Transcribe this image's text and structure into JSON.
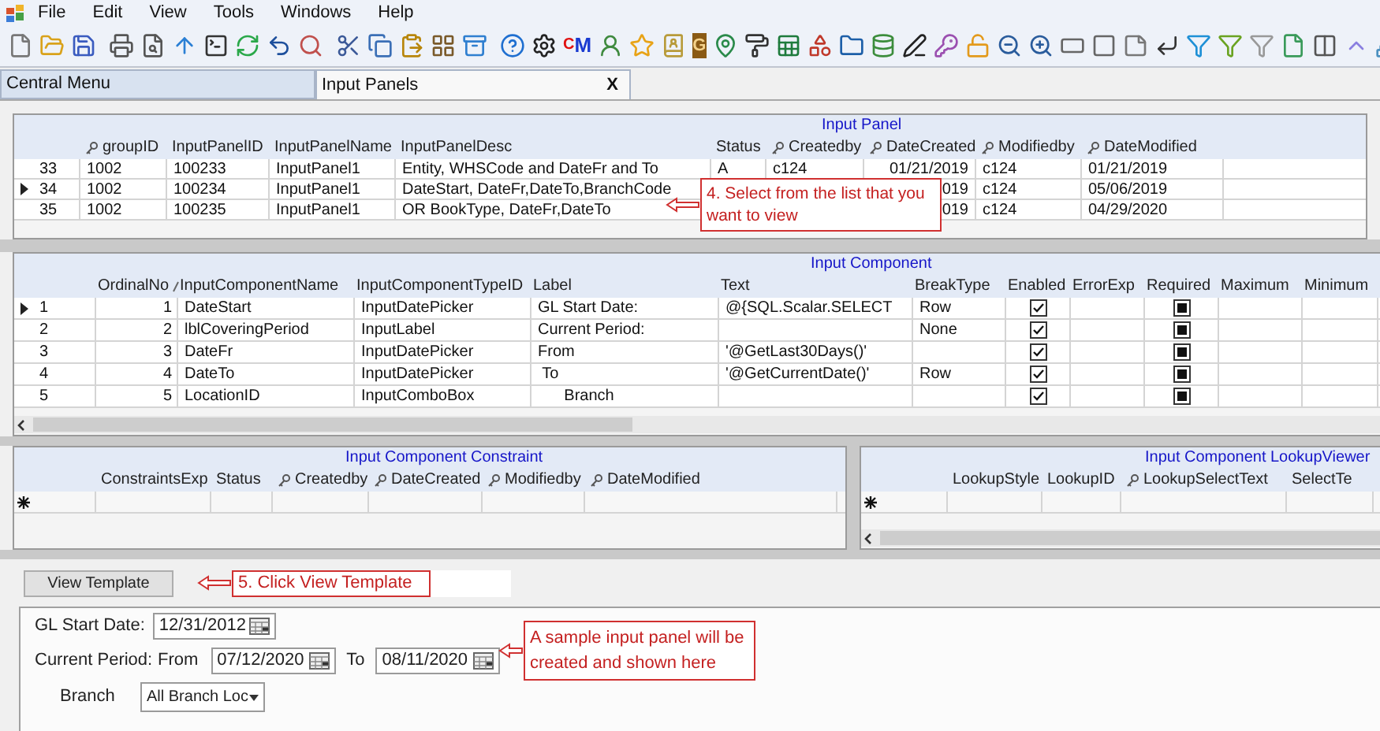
{
  "menu": [
    "File",
    "Edit",
    "View",
    "Tools",
    "Windows",
    "Help"
  ],
  "toolbar": {
    "letter_icons": [
      {
        "kind": "cm",
        "text": "CM"
      },
      {
        "kind": "tile",
        "text": "G"
      }
    ]
  },
  "tabs": [
    {
      "label": "Central Menu",
      "selected": false
    },
    {
      "label": "Input Panels",
      "selected": true,
      "close": "X"
    }
  ],
  "input_panel": {
    "title": "Input Panel",
    "columns": [
      {
        "label": "groupID",
        "key": true
      },
      {
        "label": "InputPanelID",
        "key": false
      },
      {
        "label": "InputPanelName",
        "key": false
      },
      {
        "label": "InputPanelDesc",
        "key": false
      },
      {
        "label": "Status",
        "key": false
      },
      {
        "label": "Createdby",
        "key": true
      },
      {
        "label": "DateCreated",
        "key": true
      },
      {
        "label": "Modifiedby",
        "key": true
      },
      {
        "label": "DateModified",
        "key": true
      }
    ],
    "rows": [
      {
        "selected": false,
        "id": "33",
        "cells": [
          "1002",
          "100233",
          "InputPanel1",
          "Entity, WHSCode and DateFr and To",
          "A",
          "c124",
          "01/21/2019",
          "c124",
          "01/21/2019"
        ]
      },
      {
        "selected": true,
        "id": "34",
        "cells": [
          "1002",
          "100234",
          "InputPanel1",
          "DateStart, DateFr,DateTo,BranchCode",
          null,
          null,
          "019",
          "c124",
          "05/06/2019"
        ]
      },
      {
        "selected": false,
        "id": "35",
        "cells": [
          "1002",
          "100235",
          "InputPanel1",
          "OR BookType, DateFr,DateTo",
          null,
          null,
          "019",
          "c124",
          "04/29/2020"
        ]
      }
    ],
    "callout": "4. Select from the list that you want to view"
  },
  "input_component": {
    "title": "Input Component",
    "columns": [
      {
        "label": "OrdinalNo",
        "kind": "number",
        "sorted": true
      },
      {
        "label": "InputComponentName",
        "kind": "text",
        "sorted": false
      },
      {
        "label": "InputComponentTypeID",
        "kind": "text",
        "sorted": false
      },
      {
        "label": "Label",
        "kind": "text",
        "sorted": false
      },
      {
        "label": "Text",
        "kind": "text",
        "sorted": false
      },
      {
        "label": "BreakType",
        "kind": "text",
        "sorted": false
      },
      {
        "label": "Enabled",
        "kind": "checkbox",
        "sorted": false
      },
      {
        "label": "ErrorExp",
        "kind": "text",
        "sorted": false
      },
      {
        "label": "Required",
        "kind": "square",
        "sorted": false
      },
      {
        "label": "Maximum",
        "kind": "text",
        "sorted": false
      },
      {
        "label": "Minimum",
        "kind": "text",
        "sorted": false
      }
    ],
    "rows": [
      {
        "selected": true,
        "id": "1",
        "cells": [
          "1",
          "DateStart",
          "InputDatePicker",
          "GL Start Date:",
          "@{SQL.Scalar.SELECT",
          "Row",
          true,
          null,
          true,
          null,
          null
        ]
      },
      {
        "selected": false,
        "id": "2",
        "cells": [
          "2",
          "lblCoveringPeriod",
          "InputLabel",
          "Current Period:",
          null,
          "None",
          true,
          null,
          true,
          null,
          null
        ]
      },
      {
        "selected": false,
        "id": "3",
        "cells": [
          "3",
          "DateFr",
          "InputDatePicker",
          "From",
          "'@GetLast30Days()'",
          null,
          true,
          null,
          true,
          null,
          null
        ]
      },
      {
        "selected": false,
        "id": "4",
        "cells": [
          "4",
          "DateTo",
          "InputDatePicker",
          " To",
          "'@GetCurrentDate()'",
          "Row",
          true,
          null,
          true,
          null,
          null
        ]
      },
      {
        "selected": false,
        "id": "5",
        "cells": [
          "5",
          "LocationID",
          "InputComboBox",
          "      Branch",
          null,
          null,
          true,
          null,
          true,
          null,
          null
        ]
      }
    ]
  },
  "constraint": {
    "title": "Input Component Constraint",
    "columns": [
      {
        "label": "ConstraintsExp",
        "key": false
      },
      {
        "label": "Status",
        "key": false
      },
      {
        "label": "Createdby",
        "key": true
      },
      {
        "label": "DateCreated",
        "key": true
      },
      {
        "label": "Modifiedby",
        "key": true
      },
      {
        "label": "DateModified",
        "key": true
      }
    ]
  },
  "lookup": {
    "title": "Input Component LookupViewer",
    "columns": [
      {
        "label": "LookupStyle",
        "key": false
      },
      {
        "label": "LookupID",
        "key": false
      },
      {
        "label": "LookupSelectText",
        "key": true
      },
      {
        "label": "SelectTe",
        "key": false
      }
    ]
  },
  "template": {
    "button": "View Template",
    "callout": "5. Click View Template"
  },
  "form": {
    "gl_start": {
      "label": "GL Start Date:",
      "value": "12/31/2012"
    },
    "period": {
      "label": "Current Period:",
      "from_label": "From",
      "from": "07/12/2020",
      "to_label": "To",
      "to": "08/11/2020"
    },
    "branch": {
      "label": "Branch",
      "value": "All Branch Loc"
    },
    "callout": "A sample input panel will be created and shown here"
  }
}
